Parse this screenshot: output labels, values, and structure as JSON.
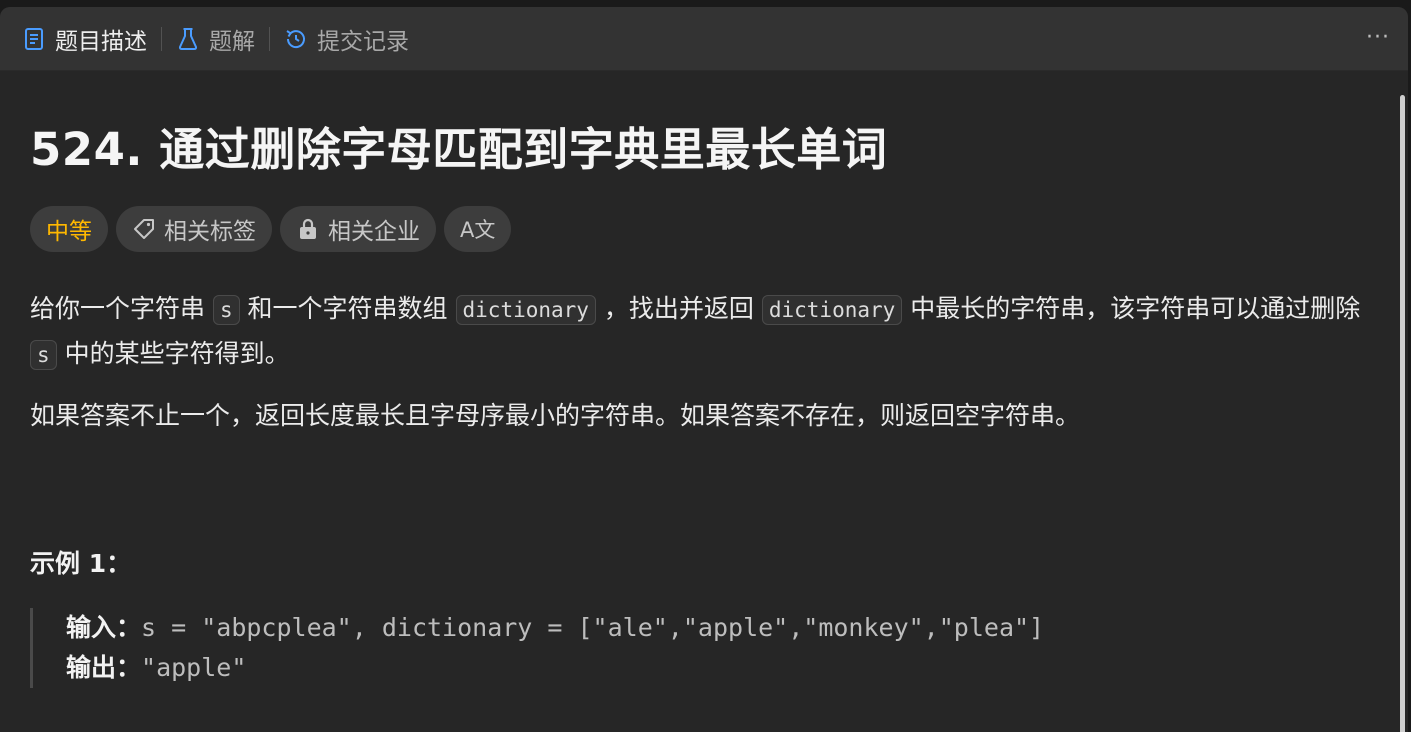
{
  "tabs": [
    {
      "label": "题目描述",
      "icon": "document-icon"
    },
    {
      "label": "题解",
      "icon": "flask-icon"
    },
    {
      "label": "提交记录",
      "icon": "history-icon"
    }
  ],
  "more_label": "···",
  "problem": {
    "title": "524. 通过删除字母匹配到字典里最长单词"
  },
  "tags": {
    "difficulty": "中等",
    "related_tags": "相关标签",
    "related_companies": "相关企业",
    "translate_icon_text": "A文"
  },
  "description": {
    "p1_a": "给你一个字符串 ",
    "code_s": "s",
    "p1_b": " 和一个字符串数组 ",
    "code_dict": "dictionary",
    "p1_c": " ，找出并返回 ",
    "p1_d": " 中最长的字符串，该字符串可以通过删除 ",
    "p1_e": " 中的某些字符得到。",
    "p2": "如果答案不止一个，返回长度最长且字母序最小的字符串。如果答案不存在，则返回空字符串。"
  },
  "example1": {
    "title": "示例 1：",
    "input_label": "输入：",
    "input_value": "s = \"abpcplea\", dictionary = [\"ale\",\"apple\",\"monkey\",\"plea\"]",
    "output_label": "输出：",
    "output_value": "\"apple\""
  },
  "colors": {
    "difficulty_medium": "#ffb800",
    "background": "#262626",
    "tabbar": "#333333"
  }
}
